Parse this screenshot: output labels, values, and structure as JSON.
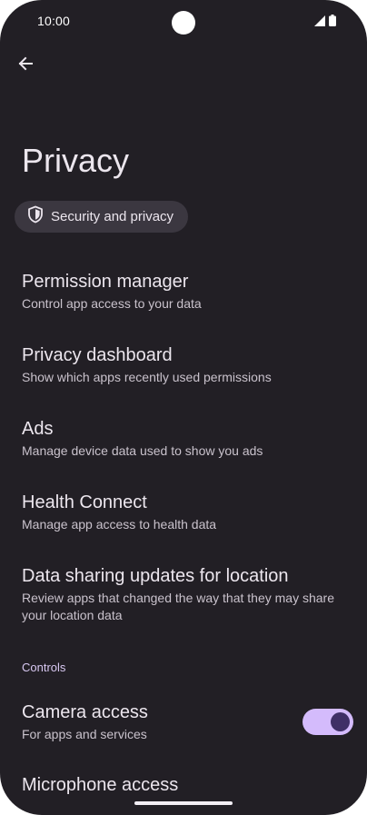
{
  "status_bar": {
    "time": "10:00"
  },
  "header": {
    "title": "Privacy"
  },
  "breadcrumb": {
    "label": "Security and privacy",
    "icon": "shield-icon"
  },
  "items": [
    {
      "title": "Permission manager",
      "subtitle": "Control app access to your data"
    },
    {
      "title": "Privacy dashboard",
      "subtitle": "Show which apps recently used permissions"
    },
    {
      "title": "Ads",
      "subtitle": "Manage device data used to show you ads"
    },
    {
      "title": "Health Connect",
      "subtitle": "Manage app access to health data"
    },
    {
      "title": "Data sharing updates for location",
      "subtitle": "Review apps that changed the way that they may share your location data"
    }
  ],
  "controls": {
    "header": "Controls",
    "camera": {
      "title": "Camera access",
      "subtitle": "For apps and services",
      "enabled": true
    },
    "microphone": {
      "title": "Microphone access"
    }
  },
  "colors": {
    "background": "#221f25",
    "chip": "#3b3740",
    "accent": "#d4bbfc",
    "section_header": "#d8c8f2"
  }
}
